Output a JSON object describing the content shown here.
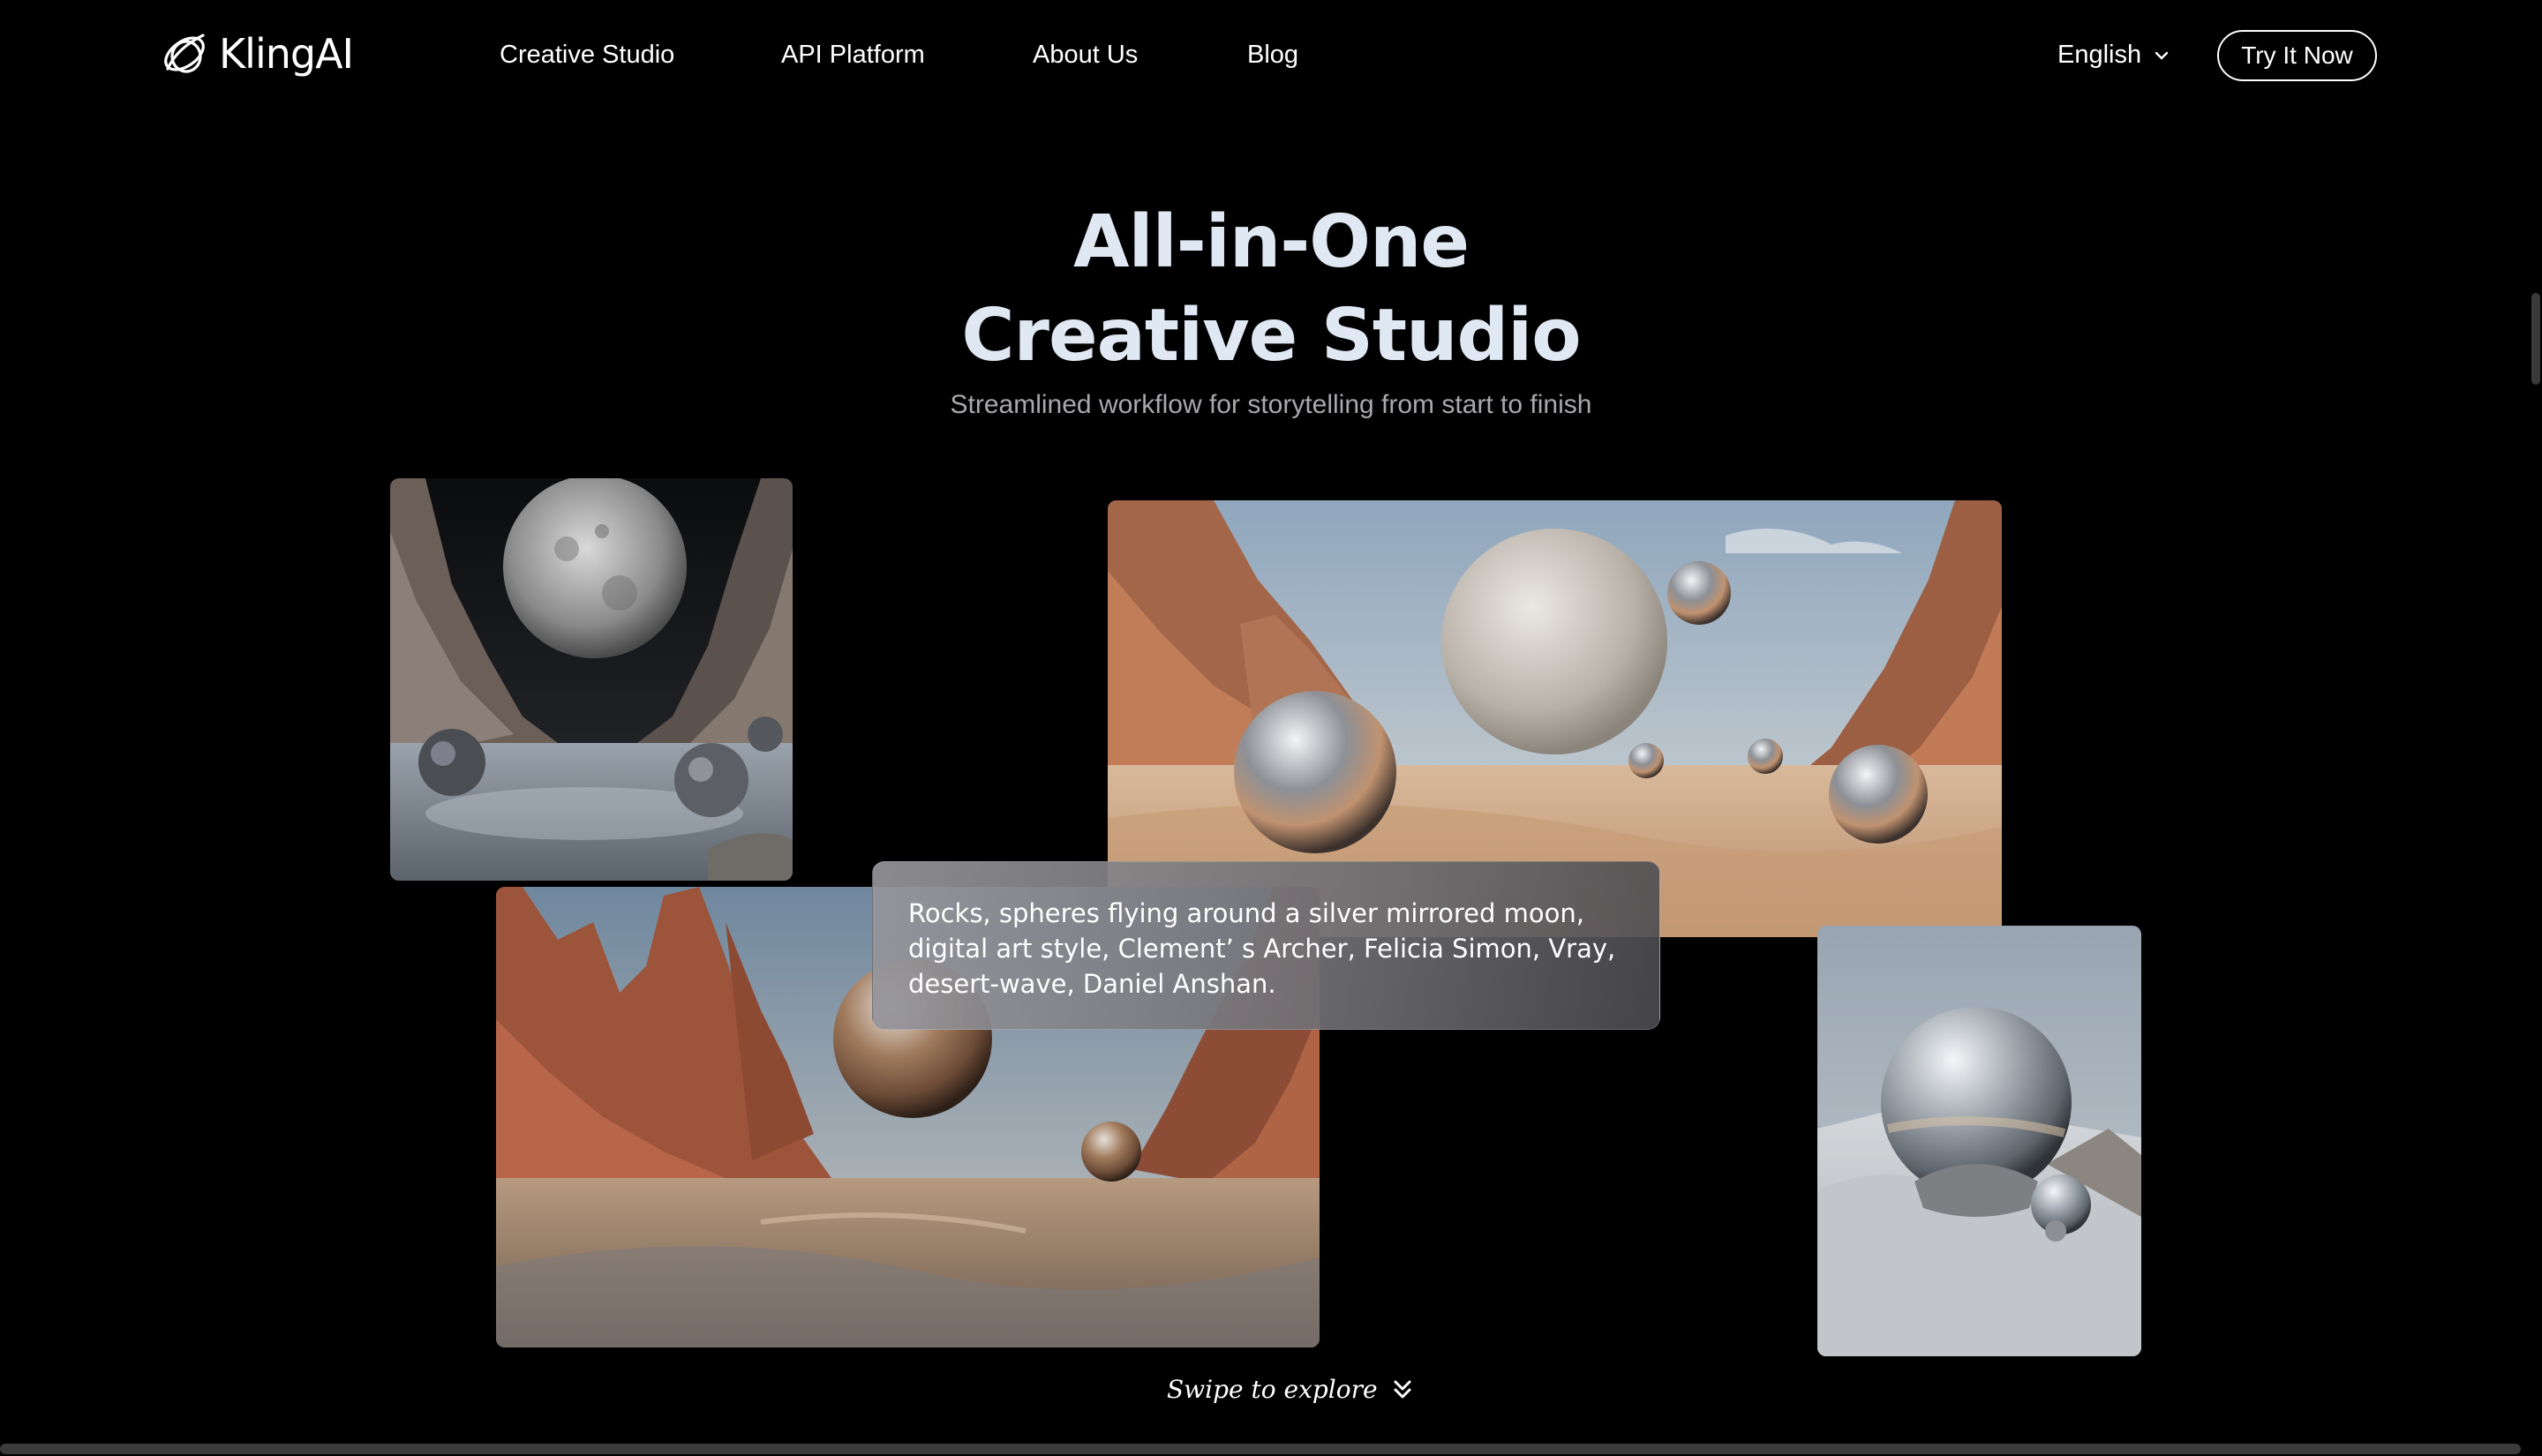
{
  "nav": {
    "brand": "KlingAI",
    "links": [
      "Creative Studio",
      "API Platform",
      "About Us",
      "Blog"
    ],
    "language": "English",
    "cta": "Try It Now"
  },
  "hero": {
    "title_line1": "All-in-One",
    "title_line2": "Creative Studio",
    "subtitle": "Streamlined workflow for storytelling from start to finish"
  },
  "prompt": {
    "text": "Rocks, spheres flying around a silver mirrored moon, digital art style, Clement’ s Archer, Felicia Simon, Vray, desert-wave, Daniel Anshan."
  },
  "swipe": {
    "label": "Swipe to explore"
  },
  "icons": {
    "logo": "kling-logo-icon",
    "language_chevron": "chevron-down-icon",
    "swipe": "double-chevron-down-icon"
  },
  "colors": {
    "background": "#000000",
    "title": "#dfe8f3",
    "subtitle": "#a8a8ad"
  }
}
